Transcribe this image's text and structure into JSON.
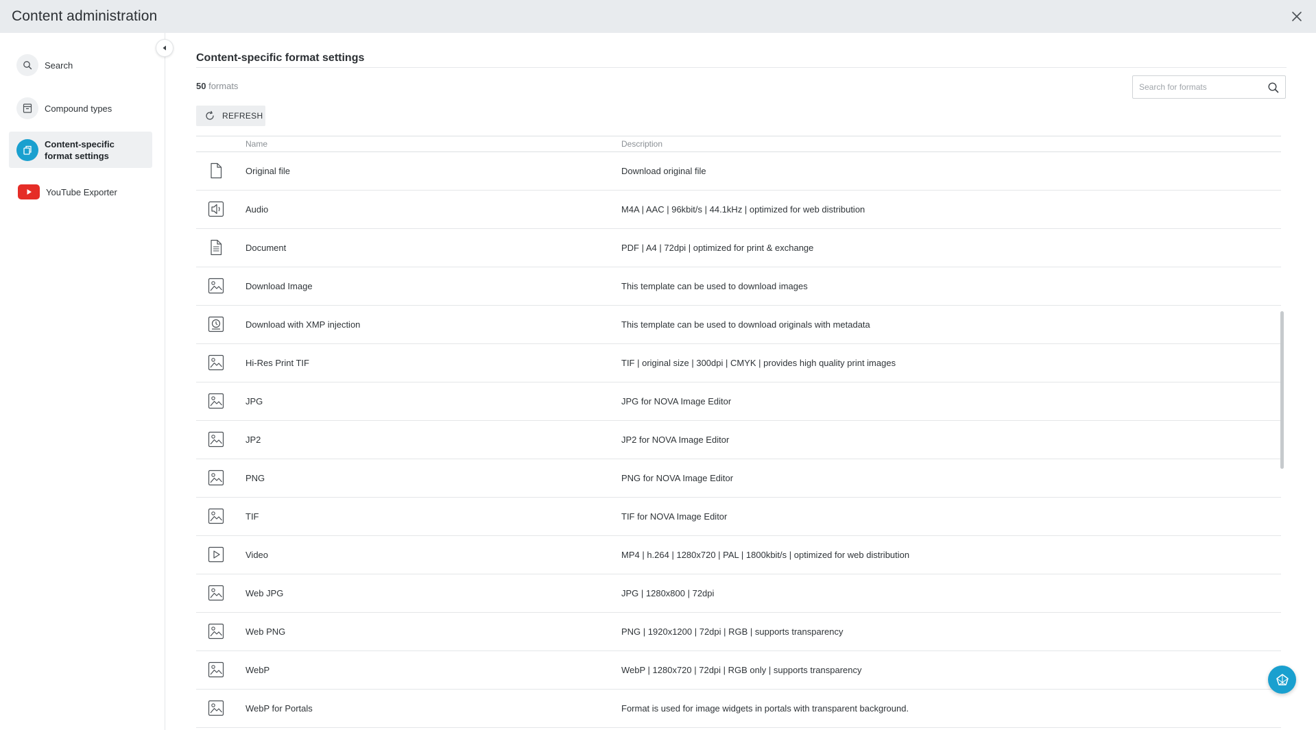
{
  "app": {
    "title": "Content administration"
  },
  "colors": {
    "accent": "#1aa0cf",
    "youtube_red": "#e52d27",
    "header_bg": "#e8ebee",
    "active_item_bg": "#eef0f2"
  },
  "sidebar": {
    "items": [
      {
        "label": "Search",
        "icon": "search-icon",
        "active": false
      },
      {
        "label": "Compound types",
        "icon": "compound-types-icon",
        "active": false
      },
      {
        "label": "Content-specific format settings",
        "icon": "format-settings-icon",
        "active": true
      },
      {
        "label": "YouTube Exporter",
        "icon": "youtube-icon",
        "active": false
      }
    ]
  },
  "main": {
    "title": "Content-specific format settings",
    "count_value": "50",
    "count_unit": "formats",
    "search_placeholder": "Search for formats",
    "refresh_label": "REFRESH",
    "columns": {
      "name": "Name",
      "description": "Description"
    },
    "rows": [
      {
        "icon": "file-icon",
        "name": "Original file",
        "description": "Download original file"
      },
      {
        "icon": "audio-icon",
        "name": "Audio",
        "description": "M4A | AAC | 96kbit/s | 44.1kHz | optimized for web distribution"
      },
      {
        "icon": "document-icon",
        "name": "Document",
        "description": "PDF | A4 | 72dpi | optimized for print & exchange"
      },
      {
        "icon": "image-icon",
        "name": "Download Image",
        "description": "This template can be used to download images"
      },
      {
        "icon": "xmp-icon",
        "name": "Download with XMP injection",
        "description": "This template can be used to download originals with metadata"
      },
      {
        "icon": "image-icon",
        "name": "Hi-Res Print TIF",
        "description": "TIF | original size | 300dpi | CMYK | provides high quality print images"
      },
      {
        "icon": "image-icon",
        "name": "JPG",
        "description": "JPG for NOVA Image Editor"
      },
      {
        "icon": "image-icon",
        "name": "JP2",
        "description": "JP2 for NOVA Image Editor"
      },
      {
        "icon": "image-icon",
        "name": "PNG",
        "description": "PNG for NOVA Image Editor"
      },
      {
        "icon": "image-icon",
        "name": "TIF",
        "description": "TIF for NOVA Image Editor"
      },
      {
        "icon": "video-icon",
        "name": "Video",
        "description": "MP4 | h.264 | 1280x720 | PAL | 1800kbit/s | optimized for web distribution"
      },
      {
        "icon": "image-icon",
        "name": "Web JPG",
        "description": "JPG | 1280x800 | 72dpi"
      },
      {
        "icon": "image-icon",
        "name": "Web PNG",
        "description": "PNG | 1920x1200 | 72dpi | RGB | supports transparency"
      },
      {
        "icon": "image-icon",
        "name": "WebP",
        "description": "WebP | 1280x720 | 72dpi | RGB only | supports transparency"
      },
      {
        "icon": "image-icon",
        "name": "WebP for Portals",
        "description": "Format is used for image widgets in portals with transparent background."
      }
    ]
  }
}
